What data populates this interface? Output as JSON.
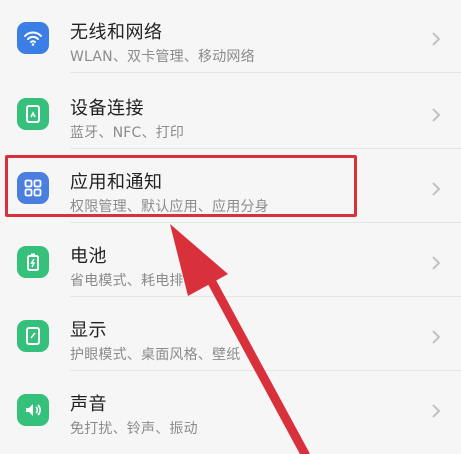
{
  "settings": {
    "items": [
      {
        "title": "无线和网络",
        "subtitle": "WLAN、双卡管理、移动网络",
        "icon": "wifi-icon",
        "color": "#3b7fe6"
      },
      {
        "title": "设备连接",
        "subtitle": "蓝牙、NFC、打印",
        "icon": "device-connect-icon",
        "color": "#35c17b"
      },
      {
        "title": "应用和通知",
        "subtitle": "权限管理、默认应用、应用分身",
        "icon": "apps-grid-icon",
        "color": "#4a7fe0"
      },
      {
        "title": "电池",
        "subtitle": "省电模式、耗电排行",
        "icon": "battery-icon",
        "color": "#35c17b"
      },
      {
        "title": "显示",
        "subtitle": "护眼模式、桌面风格、壁纸",
        "icon": "display-icon",
        "color": "#35c17b"
      },
      {
        "title": "声音",
        "subtitle": "免打扰、铃声、振动",
        "icon": "sound-icon",
        "color": "#35c17b"
      }
    ]
  },
  "annotation": {
    "highlight_color": "#d9313c"
  }
}
